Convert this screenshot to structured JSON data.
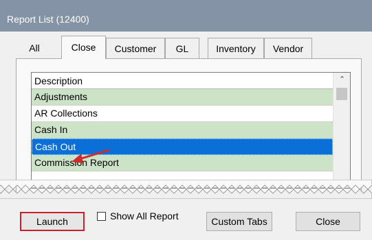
{
  "window": {
    "title": "Report List (12400)"
  },
  "tabs": [
    {
      "label": "All"
    },
    {
      "label": "Close"
    },
    {
      "label": "Customer"
    },
    {
      "label": "GL"
    },
    {
      "label": "Inventory"
    },
    {
      "label": "Vendor"
    }
  ],
  "active_tab": "Close",
  "grid": {
    "column_header": "Description",
    "rows": [
      {
        "label": "Adjustments"
      },
      {
        "label": "AR Collections"
      },
      {
        "label": "Cash In"
      },
      {
        "label": "Cash Out"
      },
      {
        "label": "Commission Report"
      }
    ],
    "selected_row": "Cash Out"
  },
  "footer": {
    "launch_label": "Launch",
    "show_all_label": "Show All Report",
    "show_all_checked": false,
    "custom_tabs_label": "Custom Tabs",
    "close_label": "Close"
  },
  "colors": {
    "titlebar": "#8493a5",
    "row_green": "#cde3c8",
    "selection": "#0a6fd6",
    "highlight_border": "#c8202a",
    "annotation_arrow": "#d22b2b"
  },
  "icons": {
    "scroll_up": "chevron-up-icon",
    "annotation": "red-arrow-icon"
  }
}
